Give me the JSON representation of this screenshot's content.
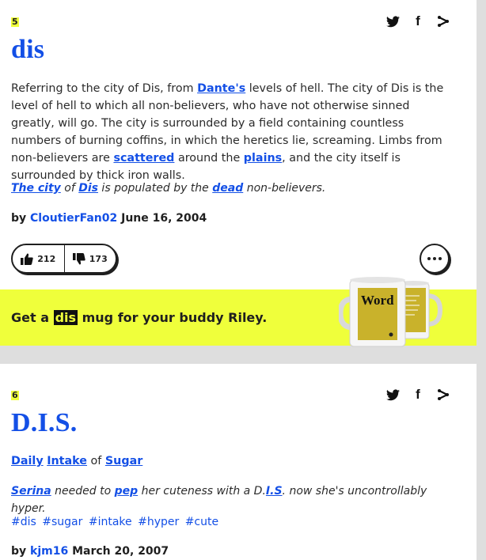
{
  "definitions": [
    {
      "number": "5",
      "word": "dis",
      "meaning": {
        "t1": "Referring to the city of Dis, from ",
        "l1": "Dante's",
        "t2": " levels of hell. The city of Dis is the level of hell to which all non-believers, who have not otherwise sinned greatly, will go. The city is surrounded by a field containing countless numbers of burning coffins, in which the heretics lie, screaming. Limbs from non-believers are ",
        "l2": "scattered",
        "t3": " around the ",
        "l3": "plains",
        "t4": ", and the city itself is surrounded by thick iron walls."
      },
      "example": {
        "l1": "The city",
        "t1": " of ",
        "l2": "Dis",
        "t2": " is populated by the ",
        "l3": "dead",
        "t3": " non-believers."
      },
      "by_label": "by",
      "author": "CloutierFan02",
      "date": "June 16, 2004",
      "upvotes": "212",
      "downvotes": "173"
    },
    {
      "number": "6",
      "word": "D.I.S.",
      "meaning": {
        "l1": "Daily",
        "l2": "Intake",
        "t1": " of ",
        "l3": "Sugar"
      },
      "example": {
        "l1": "Serina",
        "t1": " needed to ",
        "l2": "pep",
        "t2": " her cuteness with a D.",
        "l3": "I.S",
        "t3": ". now she's uncontrollably hyper."
      },
      "tags": [
        "#dis",
        "#sugar",
        "#intake",
        "#hyper",
        "#cute"
      ],
      "by_label": "by",
      "author": "kjm16",
      "date": "March 20, 2007"
    }
  ],
  "promo": {
    "prefix": "Get a ",
    "highlight": "dis",
    "suffix": " mug for your buddy Riley.",
    "mug_word": "Word"
  },
  "icons": {
    "twitter": "twitter-icon",
    "facebook": "facebook-icon",
    "share": "share-icon",
    "thumbs_up": "thumbs-up-icon",
    "thumbs_down": "thumbs-down-icon",
    "more": "more-options-icon"
  },
  "colors": {
    "link_blue": "#134fe6",
    "highlight_yellow": "#efff3b",
    "background": "#dedede",
    "mug_panel": "#c9b22b"
  }
}
